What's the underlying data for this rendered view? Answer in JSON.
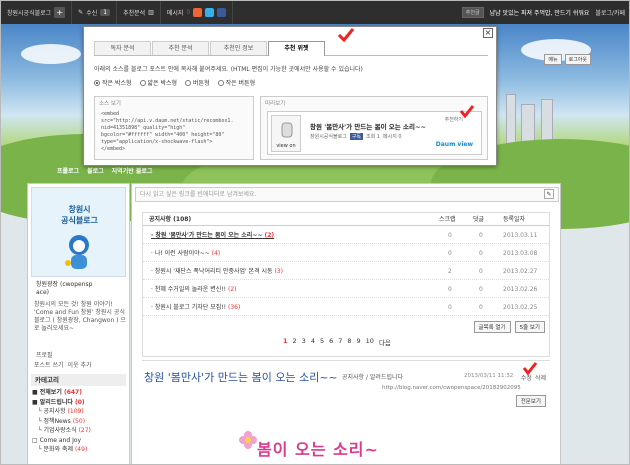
{
  "topbar": {
    "blog_name": "창원시공식블로그",
    "recommend_label": "수신",
    "recommend_count": "1",
    "recommend_stats": "추천분석",
    "messages_label": "메시지",
    "messages_count": "0",
    "select_label": "추천글",
    "quote": "냠냠 맛있는 퍼져 주먹밥, 만드기 쉬워요",
    "blog_cafe": "블로그/카페"
  },
  "header": {
    "menu_label": "메뉴",
    "login_label": "로그아웃",
    "nav_prologue": "프롤로그",
    "nav_blog": "블로그",
    "nav_tag": "지역기반 블로그"
  },
  "popup": {
    "tabs": [
      "독자 분석",
      "추천 분석",
      "추천인 정보",
      "추천 위젯"
    ],
    "description": "아래의 소스를 블로그 포스트 안에 복사해 붙여주세요. (HTML 편집이 가능한 곳에서만 사용할 수 있습니다)",
    "radios": [
      "작은 박스형",
      "얇은 박스형",
      "버튼형",
      "작은 버튼형"
    ],
    "source_title": "소스 보기",
    "source_code": "<embed\nsrc=\"http://api.v.daum.net/static/recombox1.\nnid=41351898\" quality=\"high\"\nbgcolor=\"#ffffff\" width=\"400\" height=\"80\"\ntype=\"application/x-shockwave-flash\">\n</embed>",
    "preview_title": "미리보기",
    "widget_title": "창원 '봄만사'가 만드는 봄이 오는 소리~~",
    "widget_blog": "창원시공식블로그",
    "widget_subscribe": "구독",
    "widget_views": "조회 1",
    "widget_comments": "메시지 0",
    "widget_like": "추천하기",
    "widget_view_on": "view on",
    "widget_logo": "Daum view"
  },
  "sidebar": {
    "logo_line1": "창원시",
    "logo_line2": "공식블로그",
    "owner": "창원광장 (cwopensp\nace)",
    "intro": "창원시의 모든 것! 창원 이야기! 'Come and Fun 창원' 창원시 공식 블로그 ( 창원광장, Changwon ) 으로 놀러오세요~",
    "profile": "프로필",
    "scrap_label": "포스트 쓰기",
    "neighbor_label": "이웃 추가",
    "category_title": "카테고리",
    "categories": [
      {
        "label": "전체보기",
        "count": "(647)"
      },
      {
        "label": "알리드립니다",
        "count": "(0)"
      },
      {
        "label": "공지사항",
        "count": "(109)"
      },
      {
        "label": "정책News",
        "count": "(50)"
      },
      {
        "label": "기업사랑소식",
        "count": "(27)"
      },
      {
        "label": "Come and Joy",
        "count": ""
      },
      {
        "label": "문화와 축제",
        "count": "(49)"
      }
    ]
  },
  "main": {
    "guest_placeholder": "다시 읽고 싶은 링크를 빈에디터로 남겨보세요.",
    "notice": {
      "title": "공지사항 (108)",
      "col_scrap": "스크랩",
      "col_comment": "덧글",
      "col_date": "등록일자",
      "rows": [
        {
          "title": "창원 '봄만사'가 만드는 봄이 오는 소리~~",
          "count": "(2)",
          "scrap": "0",
          "comment": "0",
          "date": "2013.03.11",
          "bold": true
        },
        {
          "title": "나! 이런 사람이야~~",
          "count": "(4)",
          "scrap": "0",
          "comment": "0",
          "date": "2013.03.08",
          "bold": false
        },
        {
          "title": "창원시 '재단스 폭낙어리티 안중사업' 본격 시동",
          "count": "(3)",
          "scrap": "2",
          "comment": "0",
          "date": "2013.02.27",
          "bold": false
        },
        {
          "title": "천혜 수거일의 놀라운 변신!!",
          "count": "(2)",
          "scrap": "0",
          "comment": "0",
          "date": "2013.02.26",
          "bold": false
        },
        {
          "title": "창원시 블로그 기자단 모집!!",
          "count": "(36)",
          "scrap": "0",
          "comment": "0",
          "date": "2013.02.25",
          "bold": false
        }
      ],
      "list_open": "글목록 열기",
      "per_page": "5줄 보기"
    },
    "pager": [
      "1",
      "2",
      "3",
      "4",
      "5",
      "6",
      "7",
      "8",
      "9",
      "10"
    ],
    "pager_next": "다음",
    "post": {
      "title": "창원 '봄만사'가 만드는 봄이 오는 소리~~",
      "category": "공지사항 / 알려드립니다",
      "date": "2013/03/11 11:32",
      "edit": "수정",
      "delete": "삭제",
      "url": "http://blog.naver.com/cwopenspace/20182902095",
      "lang_btn": "전문보기",
      "banner": "봄이 오는 소리~"
    }
  }
}
